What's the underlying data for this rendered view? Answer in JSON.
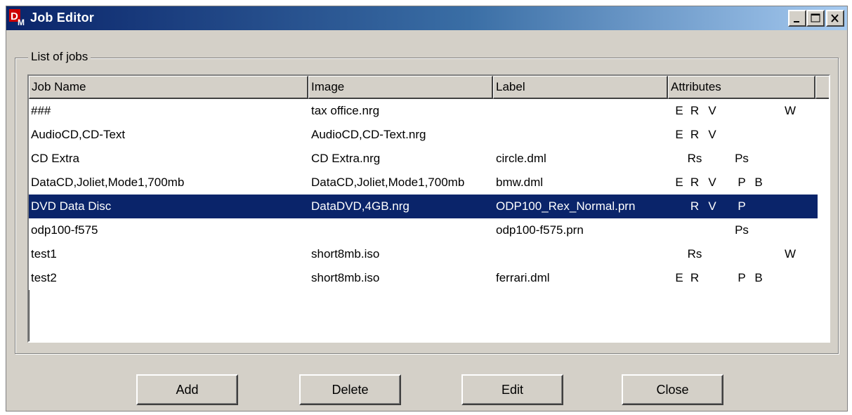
{
  "window": {
    "title": "Job Editor",
    "icon": "dvd-maker-app-icon"
  },
  "titlebar_buttons": {
    "minimize": "minimize-icon",
    "maximize": "maximize-icon",
    "close": "close-icon"
  },
  "group": {
    "label": "List of jobs"
  },
  "columns": [
    "Job Name",
    "Image",
    "Label",
    "Attributes"
  ],
  "attribute_slots": [
    "E",
    "R",
    "V",
    "P",
    "B",
    "W"
  ],
  "rows": [
    {
      "name": "###",
      "image": "tax office.nrg",
      "label": "",
      "attrs": {
        "E": "E",
        "R": "R",
        "V": "V",
        "P": "",
        "B": "",
        "W": "W"
      },
      "selected": false
    },
    {
      "name": "AudioCD,CD-Text",
      "image": "AudioCD,CD-Text.nrg",
      "label": "",
      "attrs": {
        "E": "E",
        "R": "R",
        "V": "V",
        "P": "",
        "B": "",
        "W": ""
      },
      "selected": false
    },
    {
      "name": "CD Extra",
      "image": "CD Extra.nrg",
      "label": "circle.dml",
      "attrs": {
        "E": "",
        "R": "Rs",
        "V": "",
        "P": "Ps",
        "B": "",
        "W": ""
      },
      "selected": false
    },
    {
      "name": "DataCD,Joliet,Mode1,700mb",
      "image": "DataCD,Joliet,Mode1,700mb",
      "label": "bmw.dml",
      "attrs": {
        "E": "E",
        "R": "R",
        "V": "V",
        "P": "P",
        "B": "B",
        "W": ""
      },
      "selected": false
    },
    {
      "name": "DVD Data Disc",
      "image": "DataDVD,4GB.nrg",
      "label": "ODP100_Rex_Normal.prn",
      "attrs": {
        "E": "",
        "R": "R",
        "V": "V",
        "P": "P",
        "B": "",
        "W": ""
      },
      "selected": true
    },
    {
      "name": "odp100-f575",
      "image": "",
      "label": "odp100-f575.prn",
      "attrs": {
        "E": "",
        "R": "",
        "V": "",
        "P": "Ps",
        "B": "",
        "W": ""
      },
      "selected": false
    },
    {
      "name": "test1",
      "image": "short8mb.iso",
      "label": "",
      "attrs": {
        "E": "",
        "R": "Rs",
        "V": "",
        "P": "",
        "B": "",
        "W": "W"
      },
      "selected": false
    },
    {
      "name": "test2",
      "image": "short8mb.iso",
      "label": "ferrari.dml",
      "attrs": {
        "E": "E",
        "R": "R",
        "V": "",
        "P": "P",
        "B": "B",
        "W": ""
      },
      "selected": false
    }
  ],
  "buttons": {
    "add": "Add",
    "delete": "Delete",
    "edit": "Edit",
    "close": "Close"
  },
  "colors": {
    "selection": "#0a246a",
    "face": "#d4d0c8",
    "titlebar_start": "#0a246a",
    "titlebar_end": "#a6caf0"
  }
}
